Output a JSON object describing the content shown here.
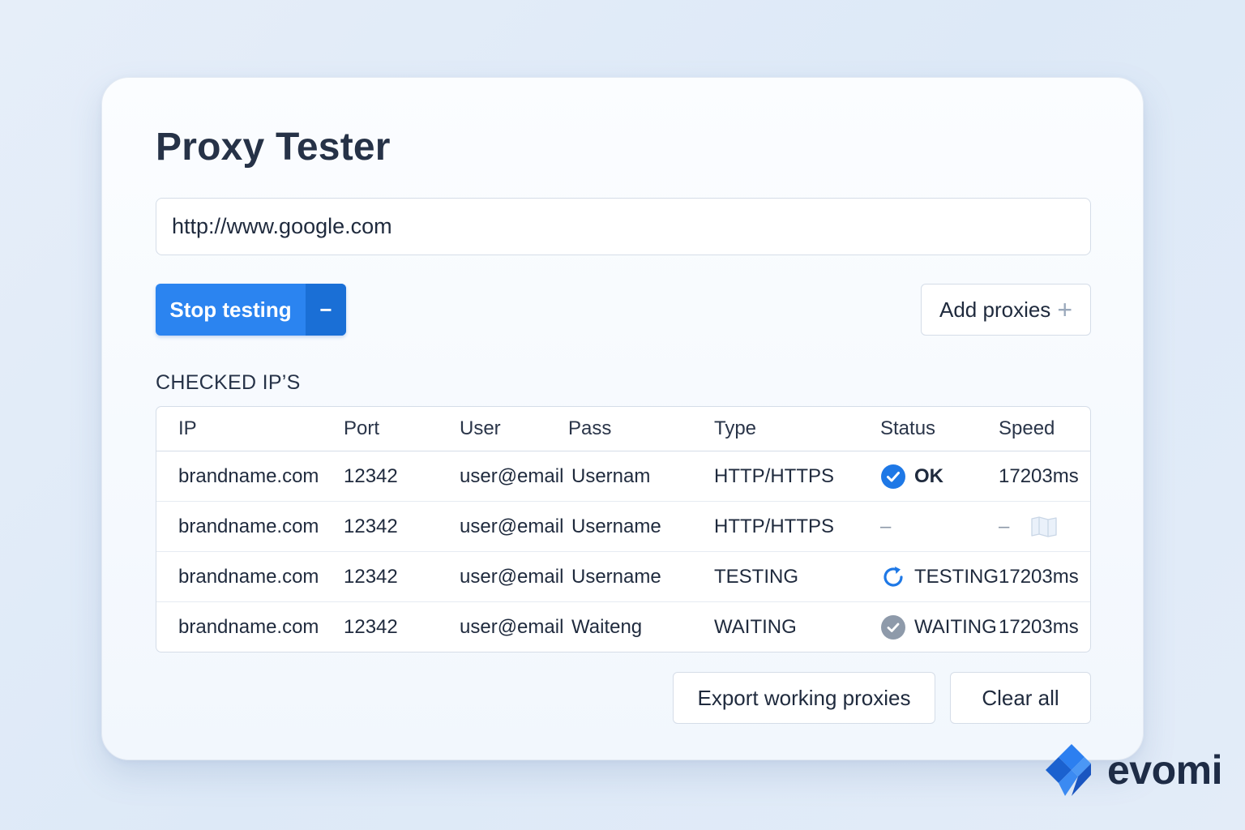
{
  "app": {
    "title": "Proxy Tester"
  },
  "url_input": {
    "value": "http://www.google.com"
  },
  "controls": {
    "stop_label": "Stop testing",
    "stop_minus": "−",
    "add_label": "Add proxies",
    "add_plus": "+"
  },
  "section": {
    "label": "CHECKED IP’S"
  },
  "table": {
    "headers": {
      "ip": "IP",
      "port": "Port",
      "user": "User",
      "pass": "Pass",
      "type": "Type",
      "status": "Status",
      "speed": "Speed"
    },
    "rows": [
      {
        "ip": "brandname.com",
        "port": "12342",
        "user": "user@email",
        "pass": "Usernam",
        "type": "HTTP/HTTPS",
        "status": "OK",
        "status_icon": "check-circle-icon",
        "speed": "17203ms"
      },
      {
        "ip": "brandname.com",
        "port": "12342",
        "user": "user@email",
        "pass": "Username",
        "type": "HTTP/HTTPS",
        "status": "–",
        "status_icon": "",
        "speed": "–",
        "extra_icon": "flag-icon"
      },
      {
        "ip": "brandname.com",
        "port": "12342",
        "user": "user@email",
        "pass": "Username",
        "type": "TESTING",
        "status": "TESTING",
        "status_icon": "refresh-icon",
        "speed": "17203ms"
      },
      {
        "ip": "brandname.com",
        "port": "12342",
        "user": "user@email",
        "pass": "Waiteng",
        "type": "WAITING",
        "status": "WAITING",
        "status_icon": "check-circle-gray-icon",
        "speed": "17203ms"
      }
    ]
  },
  "footer": {
    "export_label": "Export working proxies",
    "clear_label": "Clear all"
  },
  "brand": {
    "name": "evomi"
  },
  "colors": {
    "primary": "#2b84f0",
    "primary_dark": "#1a6fd6",
    "text": "#1f2a3d",
    "border": "#d5dde8",
    "waiting_gray": "#8e9aaa"
  }
}
